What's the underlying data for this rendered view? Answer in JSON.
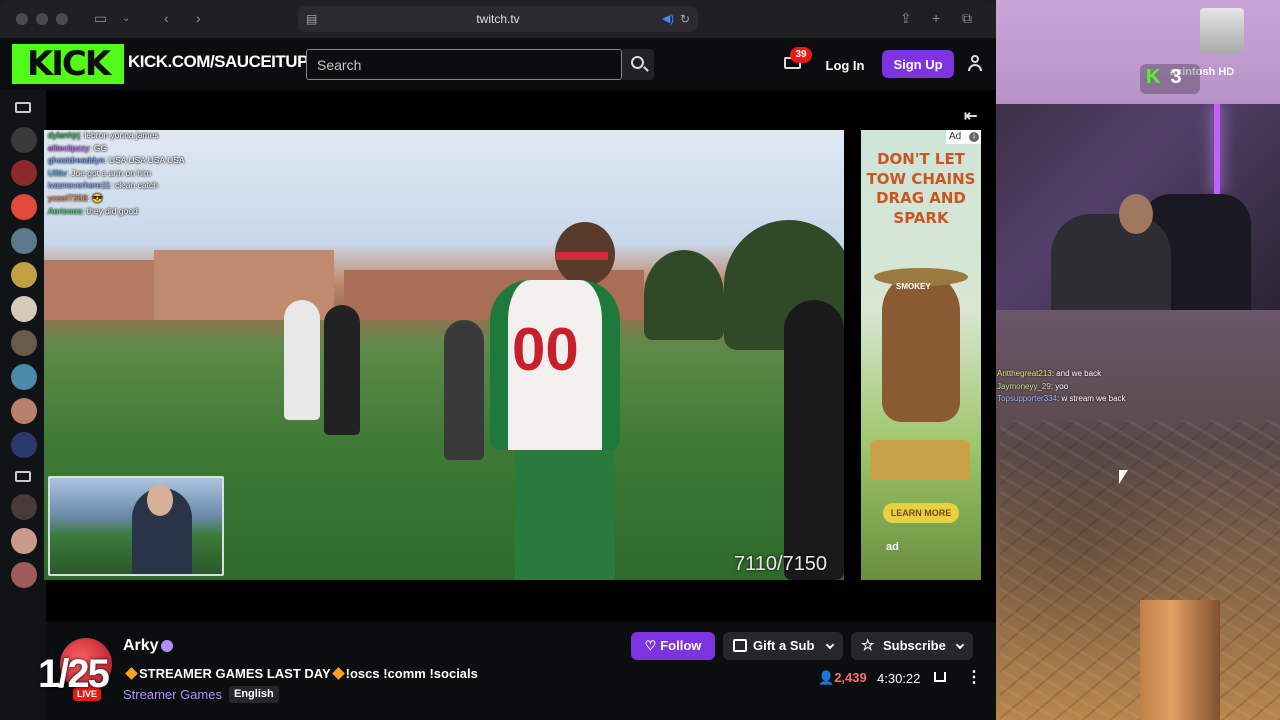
{
  "browser": {
    "url": "twitch.tv"
  },
  "header": {
    "logo": "KICK",
    "channel_url_prefix": "KICK.COM/",
    "channel_url_name": "SAUCEITUPTV",
    "search_placeholder": "Search",
    "notification_count": "39",
    "login_label": "Log In",
    "signup_label": "Sign Up"
  },
  "video_chat": [
    {
      "user": "dylanhjrj",
      "message": ": lebron yonna james"
    },
    {
      "user": "eliteclipzzy",
      "message": ": GG"
    },
    {
      "user": "ghostdreaddyn",
      "message": ": USA USA USA USA"
    },
    {
      "user": "Ulltiv",
      "message": ": Joe got a arm on him"
    },
    {
      "user": "ivasneverhere11",
      "message": ": clean catch"
    },
    {
      "user": "yosef7358",
      "message": ": 😎"
    },
    {
      "user": "Aerioooo",
      "message": ": they did good"
    }
  ],
  "overlay": {
    "jersey_number": "00",
    "counter": "7110/7150",
    "big_number": "1/25"
  },
  "ad": {
    "tag": "Ad",
    "info": "i",
    "headline": "DON'T LET TOW CHAINS DRAG AND SPARK",
    "mascot_hat": "SMOKEY",
    "cta": "LEARN MORE",
    "logos": "ad"
  },
  "desktop": {
    "disk_label": "acintosh HD",
    "kick_badge": "K",
    "kick_badge_num": "3",
    "chat": [
      {
        "user": "Antthegreat213",
        "message": ": and we back"
      },
      {
        "user": "Jaymoneyy_29",
        "message": ": yoo"
      },
      {
        "user": "Topsupporter334",
        "message": ": w stream we back"
      }
    ]
  },
  "channel": {
    "name": "Arky",
    "live_label": "LIVE",
    "title": "STREAMER GAMES LAST DAY",
    "title_suffix": "!oscs !comm !socials",
    "category": "Streamer Games",
    "language": "English",
    "viewers": "2,439",
    "uptime": "4:30:22",
    "follow_label": "Follow",
    "gift_label": "Gift a Sub",
    "subscribe_label": "Subscribe"
  },
  "colors": {
    "kick_green": "#53fc18",
    "brand_purple": "#7d34e0",
    "live_red": "#e91916"
  }
}
